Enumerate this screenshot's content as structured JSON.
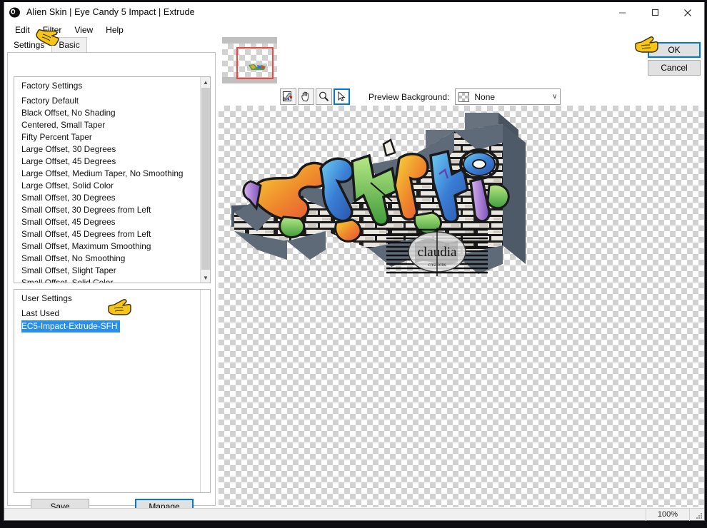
{
  "window": {
    "title": "Alien Skin | Eye Candy 5 Impact | Extrude",
    "app_icon": "alien-skin-icon",
    "minimize_label": "–",
    "maximize_label": "☐",
    "close_label": "✕"
  },
  "menubar": {
    "items": [
      {
        "label": "Edit"
      },
      {
        "label": "Filter"
      },
      {
        "label": "View"
      },
      {
        "label": "Help"
      }
    ]
  },
  "tabs": [
    {
      "label": "Settings",
      "active": true
    },
    {
      "label": "Basic",
      "active": false
    }
  ],
  "factory_list": {
    "header": "Factory Settings",
    "items": [
      "Factory Default",
      "Black Offset, No Shading",
      "Centered, Small Taper",
      "Fifty Percent Taper",
      "Large Offset, 30 Degrees",
      "Large Offset, 45 Degrees",
      "Large Offset, Medium Taper, No Smoothing",
      "Large Offset, Solid Color",
      "Small Offset, 30 Degrees",
      "Small Offset, 30 Degrees from Left",
      "Small Offset, 45 Degrees",
      "Small Offset, 45 Degrees from Left",
      "Small Offset, Maximum Smoothing",
      "Small Offset, No Smoothing",
      "Small Offset, Slight Taper",
      "Small Offset, Solid Color"
    ]
  },
  "user_list": {
    "header": "User Settings",
    "items": [
      {
        "label": "Last Used",
        "selected": false
      },
      {
        "label": "EC5-Impact-Extrude-SFH",
        "selected": true
      }
    ]
  },
  "left_buttons": {
    "save": "Save",
    "manage": "Manage"
  },
  "preview_toolbar": {
    "tools": [
      {
        "name": "eyedropper-tool",
        "active": false
      },
      {
        "name": "hand-tool",
        "active": false
      },
      {
        "name": "zoom-tool",
        "active": false
      },
      {
        "name": "arrow-tool",
        "active": true
      }
    ],
    "background_label": "Preview Background:",
    "background_value": "None",
    "caret": "∨"
  },
  "dialog_buttons": {
    "ok": "OK",
    "cancel": "Cancel"
  },
  "statusbar": {
    "zoom": "100%"
  },
  "watermark": {
    "text": "claudia",
    "subtext": "creations"
  },
  "colors": {
    "selection_blue": "#2a8fe8",
    "focus_blue": "#0078d7",
    "viewport_red": "#f2453d",
    "cursor_yellow": "#f5c518",
    "checker_gray": "#d2d2d2",
    "button_face": "#e1e1e1"
  },
  "annotations": {
    "cursor_filter_menu": "pointing-hand-cursor",
    "cursor_user_setting": "pointing-hand-cursor",
    "cursor_ok_button": "pointing-hand-cursor"
  }
}
